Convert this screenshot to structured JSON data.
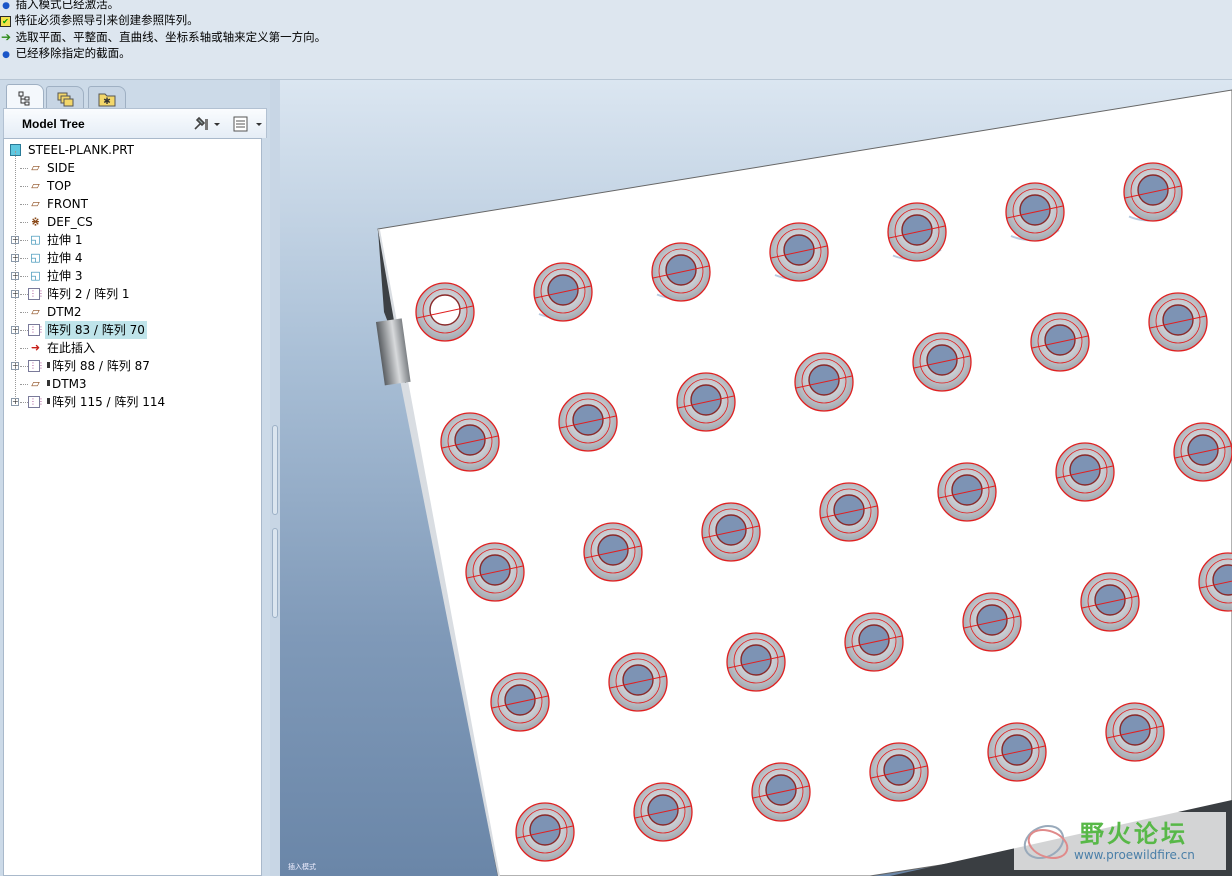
{
  "messages": [
    {
      "icon": "info-bullet-icon",
      "text": "插入模式已经激活。"
    },
    {
      "icon": "warning-icon",
      "text": "特征必须参照导引来创建参照阵列。"
    },
    {
      "icon": "green-arrow-icon",
      "text": "选取平面、平整面、直曲线、坐标系轴或轴来定义第一方向。"
    },
    {
      "icon": "info-bullet-icon",
      "text": "已经移除指定的截面。"
    }
  ],
  "left_panel": {
    "tabs": [
      "model-tree-tab-icon",
      "layers-tab-icon",
      "favorites-tab-icon"
    ],
    "title": "Model Tree",
    "settings_icon": "tree-settings-icon",
    "columns_icon": "tree-columns-icon"
  },
  "tree": {
    "root": "STEEL-PLANK.PRT",
    "items": [
      {
        "label": "SIDE",
        "type": "plane",
        "expandable": false,
        "marker": false,
        "selected": false
      },
      {
        "label": "TOP",
        "type": "plane",
        "expandable": false,
        "marker": false,
        "selected": false
      },
      {
        "label": "FRONT",
        "type": "plane",
        "expandable": false,
        "marker": false,
        "selected": false
      },
      {
        "label": "DEF_CS",
        "type": "csys",
        "expandable": false,
        "marker": false,
        "selected": false
      },
      {
        "label": "拉伸 1",
        "type": "extrude",
        "expandable": true,
        "marker": false,
        "selected": false
      },
      {
        "label": "拉伸 4",
        "type": "extrude",
        "expandable": true,
        "marker": false,
        "selected": false
      },
      {
        "label": "拉伸 3",
        "type": "extrude",
        "expandable": true,
        "marker": false,
        "selected": false
      },
      {
        "label": "阵列 2 / 阵列 1",
        "type": "pattern",
        "expandable": true,
        "marker": false,
        "selected": false
      },
      {
        "label": "DTM2",
        "type": "plane",
        "expandable": false,
        "marker": false,
        "selected": false
      },
      {
        "label": "阵列 83 / 阵列 70",
        "type": "pattern",
        "expandable": true,
        "marker": false,
        "selected": true
      },
      {
        "label": "在此插入",
        "type": "insert",
        "expandable": false,
        "marker": false,
        "selected": false
      },
      {
        "label": "阵列 88 / 阵列 87",
        "type": "pattern",
        "expandable": true,
        "marker": true,
        "selected": false
      },
      {
        "label": "DTM3",
        "type": "plane",
        "expandable": false,
        "marker": true,
        "selected": false
      },
      {
        "label": "阵列 115 / 阵列 114",
        "type": "pattern",
        "expandable": true,
        "marker": true,
        "selected": false
      }
    ]
  },
  "viewport": {
    "status_text": "插入模式",
    "plank_color": "#ffffff",
    "hole_highlight_color": "#e02020",
    "background_top": "#dbe6f1",
    "background_bottom": "#6a86a8"
  },
  "watermark": {
    "title": "野火论坛",
    "url": "www.proewildfire.cn"
  }
}
